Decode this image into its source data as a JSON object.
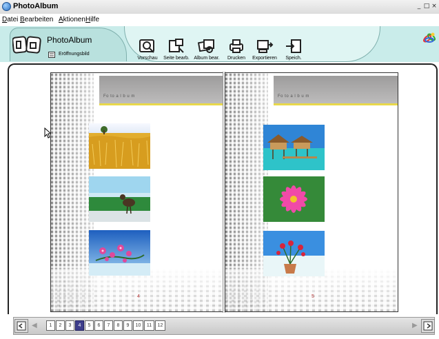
{
  "window": {
    "title": "PhotoAlbum",
    "controls": [
      "_",
      "□",
      "×"
    ]
  },
  "menu": [
    "Datei",
    "Bearbeiten",
    "Aktionen",
    "Hilfe"
  ],
  "toolbar": {
    "app_label": "PhotoAlbum",
    "cover_label": "Eröffnungsbild",
    "tools": [
      {
        "label": "Vorschau",
        "icon": "preview-icon"
      },
      {
        "label": "Seite bearb.",
        "icon": "edit-page-icon"
      },
      {
        "label": "Album bear.",
        "icon": "edit-album-icon"
      },
      {
        "label": "Drucken",
        "icon": "print-icon"
      },
      {
        "label": "Exportieren",
        "icon": "export-icon"
      },
      {
        "label": "Speich.",
        "icon": "save-icon"
      }
    ]
  },
  "album": {
    "left_page": {
      "header": "Fo to a l b u m",
      "number": "4",
      "photos": [
        "wheat-field-photo",
        "bird-on-grass-photo",
        "pink-flowers-photo"
      ]
    },
    "right_page": {
      "header": "Fo to a l b u m",
      "number": "5",
      "photos": [
        "beach-huts-photo",
        "pink-lotus-photo",
        "potted-flowers-photo"
      ]
    }
  },
  "pagination": {
    "pages": [
      "1",
      "2",
      "3",
      "4",
      "5",
      "6",
      "7",
      "8",
      "9",
      "10",
      "11",
      "12"
    ],
    "active": "4"
  }
}
